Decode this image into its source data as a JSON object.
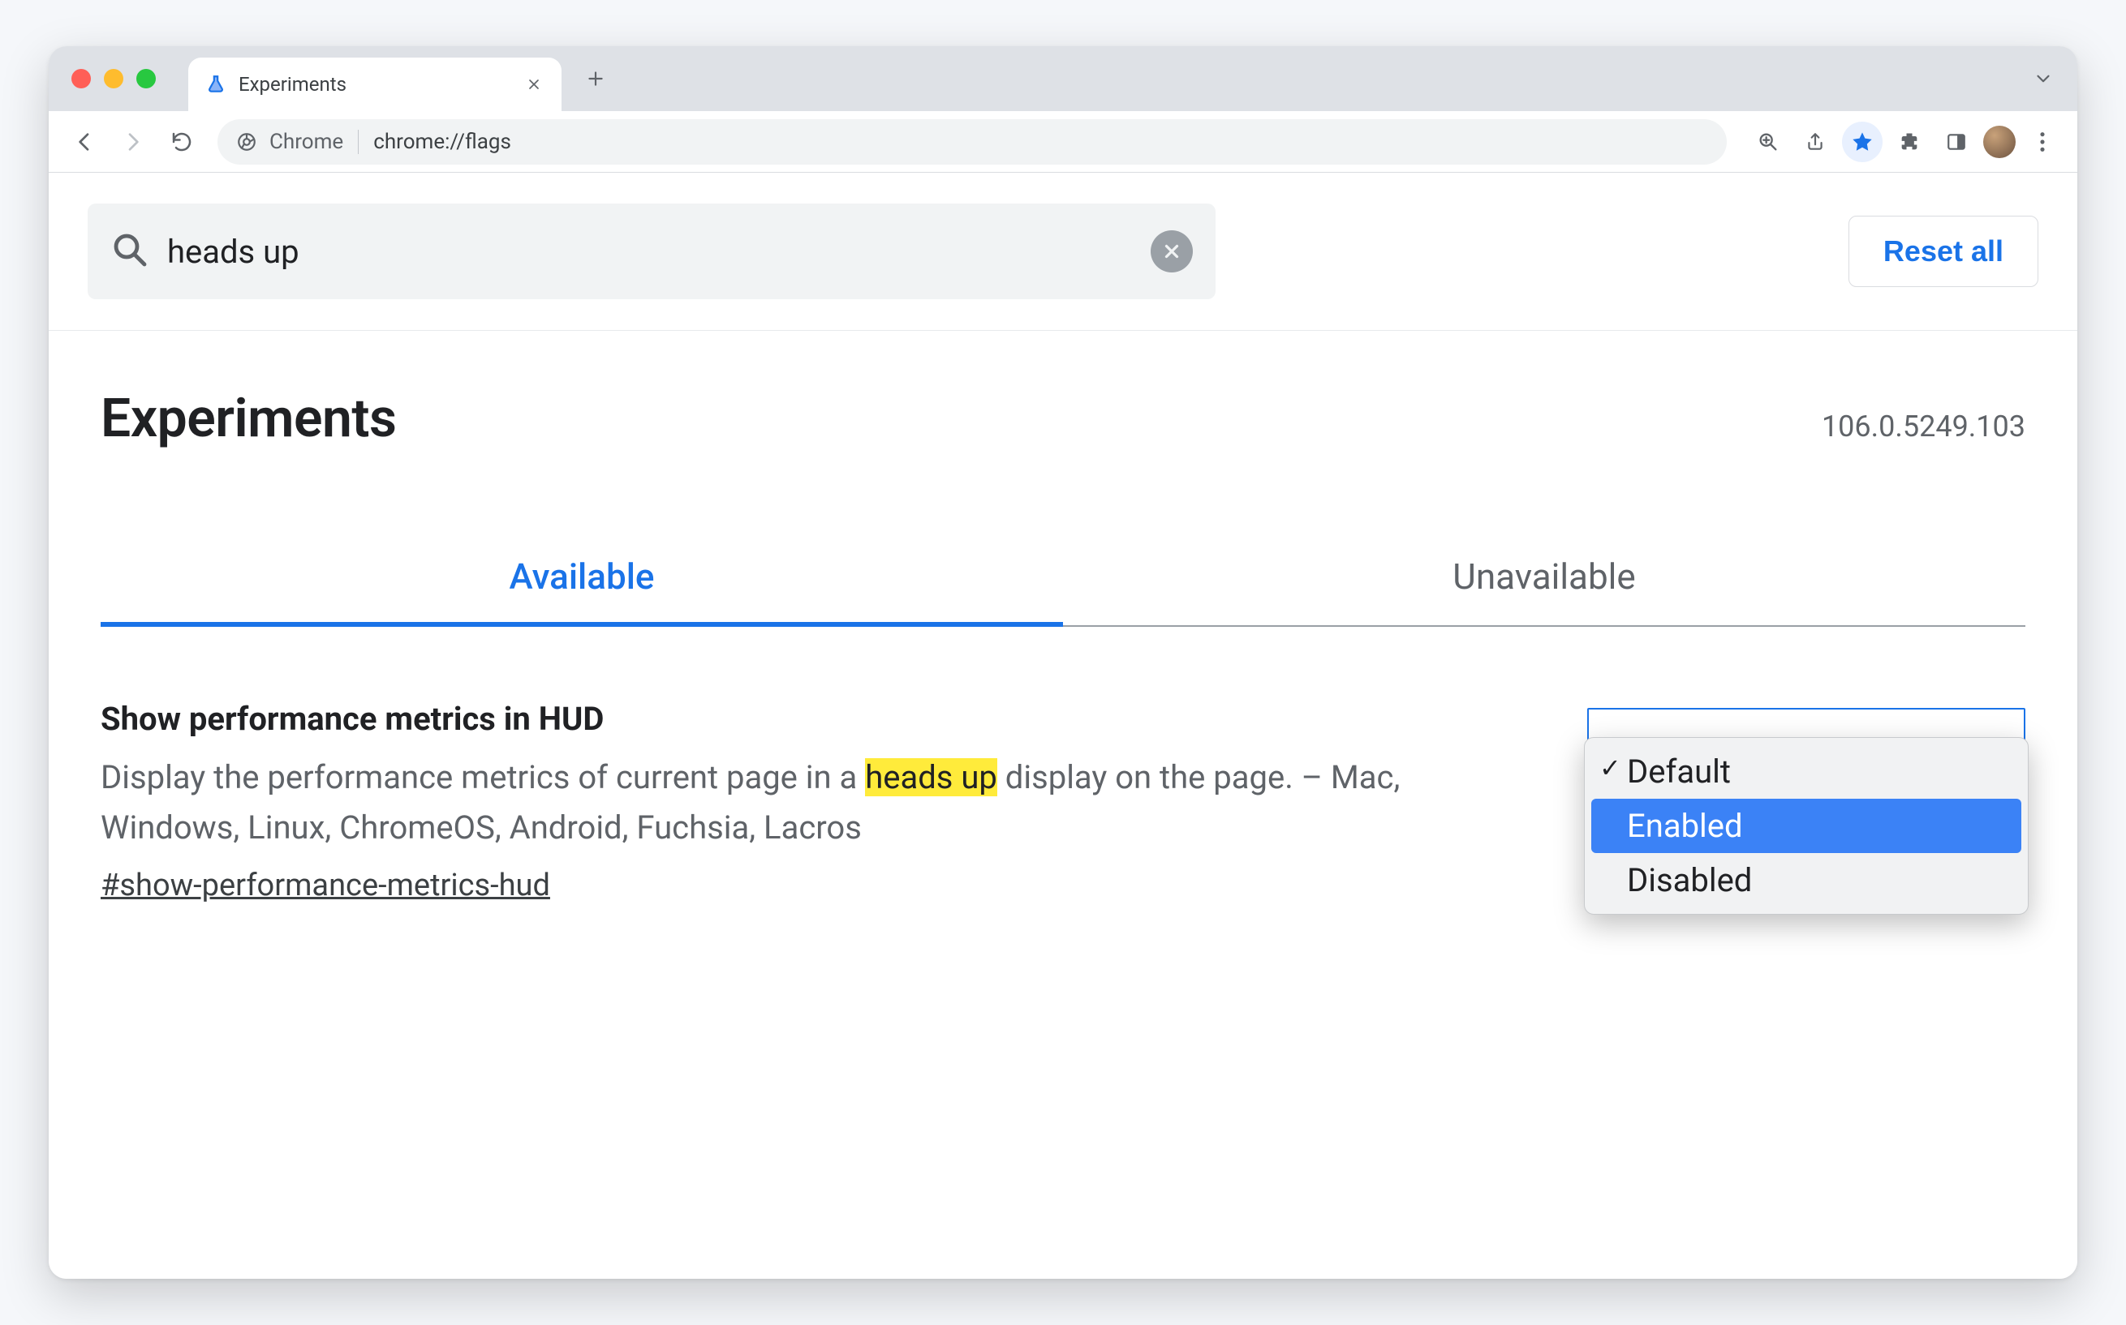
{
  "browser_tab": {
    "title": "Experiments"
  },
  "omnibox": {
    "origin_label": "Chrome",
    "url": "chrome://flags"
  },
  "search": {
    "value": "heads up"
  },
  "reset_label": "Reset all",
  "page_title": "Experiments",
  "version": "106.0.5249.103",
  "tabs": {
    "available": "Available",
    "unavailable": "Unavailable"
  },
  "flag": {
    "title": "Show performance metrics in HUD",
    "desc_before": "Display the performance metrics of current page in a ",
    "desc_highlight": "heads up",
    "desc_after": " display on the page. – Mac, Windows, Linux, ChromeOS, Android, Fuchsia, Lacros",
    "anchor": "#show-performance-metrics-hud"
  },
  "dropdown": {
    "options": {
      "default": "Default",
      "enabled": "Enabled",
      "disabled": "Disabled"
    }
  }
}
